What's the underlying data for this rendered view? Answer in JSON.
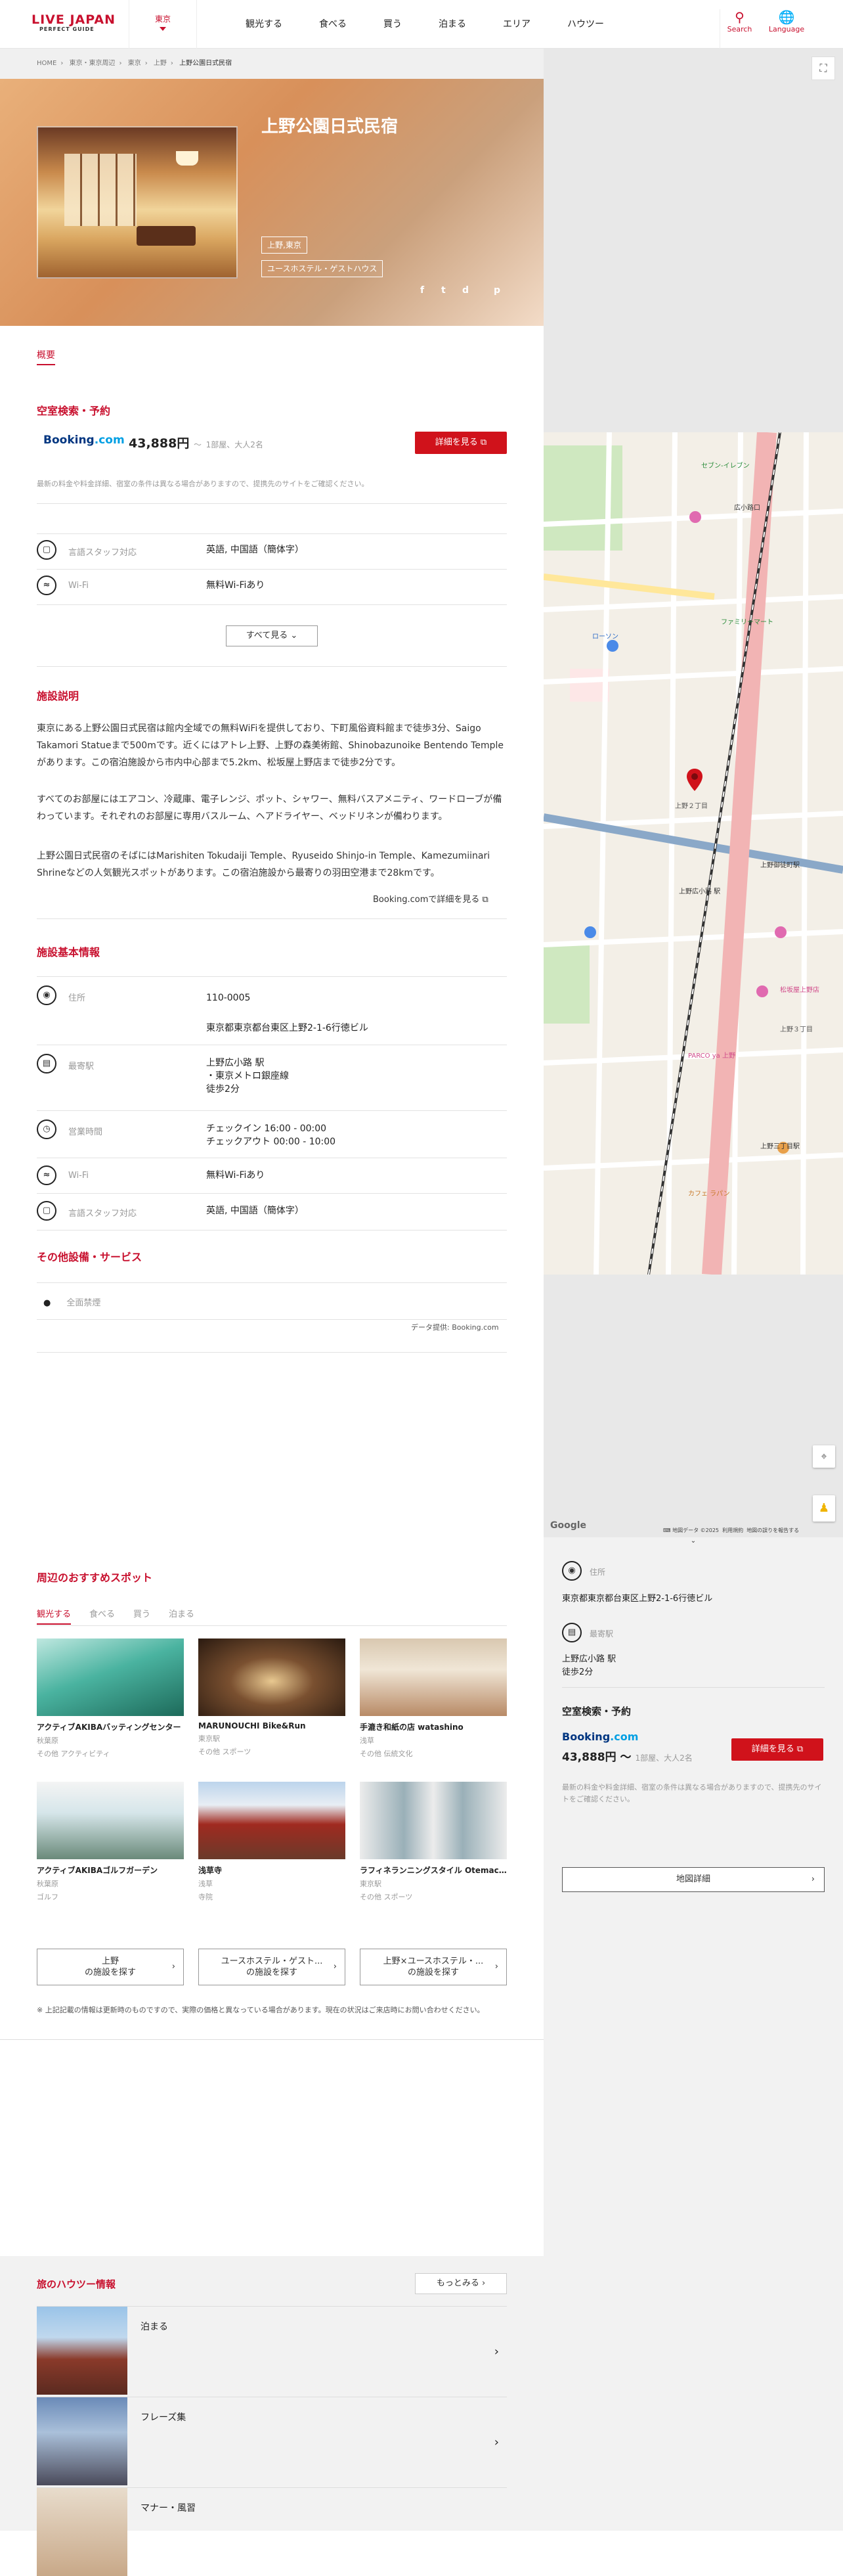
{
  "header": {
    "logo_main": "LIVE JAPAN",
    "logo_sub": "PERFECT GUIDE",
    "area": "東京",
    "nav": [
      "観光する",
      "食べる",
      "買う",
      "泊まる",
      "エリア",
      "ハウツー"
    ],
    "search": "Search",
    "language": "Language"
  },
  "breadcrumb": [
    "HOME",
    "東京・東京周辺",
    "東京",
    "上野",
    "上野公園日式民宿"
  ],
  "hero": {
    "title": "上野公園日式民宿",
    "tags": [
      "上野,東京",
      "ユースホステル・ゲストハウス"
    ],
    "share_icons": [
      "f",
      "t",
      "d",
      "p"
    ]
  },
  "tabs": {
    "overview": "概要"
  },
  "booking_section": {
    "title": "空室検索・予約",
    "provider": "Booking",
    "provider_suffix": ".com",
    "price": "43,888円",
    "price_tilde": "〜",
    "price_note": "1部屋、大人2名",
    "button": "詳細を見る",
    "disclaimer": "最新の料金や料金詳細、宿室の条件は異なる場合がありますので、提携先のサイトをご確認ください。"
  },
  "facilities": [
    {
      "label": "言語スタッフ対応",
      "value": "英語, 中国語（簡体字）"
    },
    {
      "label": "Wi-Fi",
      "value": "無料Wi-Fiあり"
    }
  ],
  "show_all": "すべて見る",
  "description": {
    "title": "施設説明",
    "paragraphs": [
      "東京にある上野公園日式民宿は館内全域での無料WiFiを提供しており、下町風俗資料館まで徒歩3分、Saigo Takamori Statueまで500mです。近くにはアトレ上野、上野の森美術館、Shinobazunoike Bentendo Templeがあります。この宿泊施設から市内中心部まで5.2km、松坂屋上野店まで徒歩2分です。",
      "すべてのお部屋にはエアコン、冷蔵庫、電子レンジ、ポット、シャワー、無料バスアメニティ、ワードローブが備わっています。それぞれのお部屋に専用バスルーム、ヘアドライヤー、ベッドリネンが備わります。",
      "上野公園日式民宿のそばにはMarishiten Tokudaiji Temple、Ryuseido Shinjo-in Temple、Kamezumiinari Shrineなどの人気観光スポットがあります。この宿泊施設から最寄りの羽田空港まで28kmです。"
    ],
    "more_link": "Booking.comで詳細を見る"
  },
  "basic_info": {
    "title": "施設基本情報",
    "rows": [
      {
        "label": "住所",
        "lines": [
          "110-0005",
          "東京都東京都台東区上野2-1-6行徳ビル"
        ]
      },
      {
        "label": "最寄駅",
        "lines": [
          "上野広小路 駅",
          "・東京メトロ銀座線",
          "徒歩2分"
        ]
      },
      {
        "label": "営業時間",
        "lines": [
          "チェックイン 16:00 - 00:00",
          "チェックアウト 00:00 - 10:00"
        ]
      },
      {
        "label": "Wi-Fi",
        "lines": [
          "無料Wi-Fiあり"
        ]
      },
      {
        "label": "言語スタッフ対応",
        "lines": [
          "英語, 中国語（簡体字）"
        ]
      }
    ]
  },
  "other_services": {
    "title": "その他設備・サービス",
    "items": [
      "全面禁煙"
    ],
    "credit": "データ提供: Booking.com"
  },
  "nearby": {
    "title": "周辺のおすすめスポット",
    "tabs": [
      "観光する",
      "食べる",
      "買う",
      "泊まる"
    ],
    "cards": [
      {
        "name": "アクティブAKIBAバッティングセンター",
        "area": "秋葉原",
        "cat": "その他  アクティビティ"
      },
      {
        "name": "MARUNOUCHI Bike&Run",
        "area": "東京駅",
        "cat": "その他  スポーツ"
      },
      {
        "name": "手漉き和紙の店 watashino",
        "area": "浅草",
        "cat": "その他  伝統文化"
      },
      {
        "name": "アクティブAKIBAゴルフガーデン",
        "area": "秋葉原",
        "cat": "ゴルフ"
      },
      {
        "name": "浅草寺",
        "area": "浅草",
        "cat": "寺院"
      },
      {
        "name": "ラフィネランニングスタイル Otemac...",
        "area": "東京駅",
        "cat": "その他  スポーツ"
      }
    ],
    "explore": [
      {
        "line1": "上野",
        "line2": "の施設を探す"
      },
      {
        "line1": "ユースホステル・ゲスト...",
        "line2": "の施設を探す"
      },
      {
        "line1": "上野×ユースホステル・...",
        "line2": "の施設を探す"
      }
    ],
    "footnote": "※ 上記記載の情報は更新時のものですので、実際の価格と異なっている場合があります。現在の状況はご来店時にお問い合わせください。"
  },
  "map": {
    "google": "Google",
    "copyright": "地図データ ©2025",
    "terms": "利用規約",
    "report": "地図の誤りを報告する",
    "labels": [
      {
        "t": "上野広小路 駅",
        "c": "#333"
      },
      {
        "t": "セブン-イレブン",
        "c": "#2a8c3a"
      },
      {
        "t": "ファミリーマート",
        "c": "#2a8c3a"
      },
      {
        "t": "ローソン",
        "c": "#2a6ac8"
      },
      {
        "t": "上野御徒町駅",
        "c": "#333"
      },
      {
        "t": "松坂屋上野店",
        "c": "#d04a8a"
      },
      {
        "t": "PARCO ya 上野",
        "c": "#d04a8a"
      },
      {
        "t": "上野三丁目駅",
        "c": "#333"
      },
      {
        "t": "広小路口",
        "c": "#333"
      },
      {
        "t": "カフェ ラパン",
        "c": "#c87a2a"
      },
      {
        "t": "上野２丁目",
        "c": "#555"
      },
      {
        "t": "上野３丁目",
        "c": "#555"
      }
    ]
  },
  "sidebar": {
    "address_label": "住所",
    "address": "東京都東京都台東区上野2-1-6行徳ビル",
    "station_label": "最寄駅",
    "station_lines": [
      "上野広小路 駅",
      "徒歩2分"
    ],
    "booking_title": "空室検索・予約",
    "provider": "Booking",
    "provider_suffix": ".com",
    "price": "43,888円 〜",
    "price_note": "1部屋、大人2名",
    "button": "詳細を見る",
    "disclaimer": "最新の料金や料金詳細、宿室の条件は異なる場合がありますので、提携先のサイトをご確認ください。",
    "map_button": "地図詳細"
  },
  "howto": {
    "title": "旅のハウツー情報",
    "more": "もっとみる",
    "items": [
      "泊まる",
      "フレーズ集",
      "マナー・風習"
    ]
  },
  "colors": {
    "accent": "#c8102e",
    "booking": "#003580"
  }
}
